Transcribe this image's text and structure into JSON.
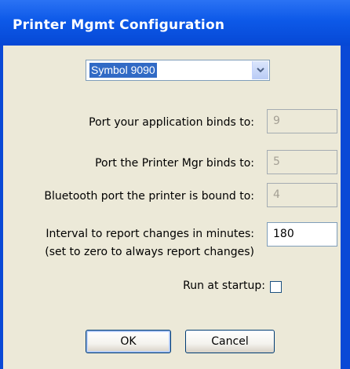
{
  "window": {
    "title": "Printer Mgmt Configuration"
  },
  "printer_select": {
    "selected": "Symbol 9090"
  },
  "fields": [
    {
      "label": "Port your application binds to:",
      "value": "9",
      "enabled": false
    },
    {
      "label": "Port the Printer Mgr binds to:",
      "value": "5",
      "enabled": false
    },
    {
      "label": "Bluetooth port the printer is bound to:",
      "value": "4",
      "enabled": false
    },
    {
      "label": "Interval to report changes in minutes:",
      "sublabel": "(set to zero to always report changes)",
      "value": "180",
      "enabled": true
    }
  ],
  "run_at_startup": {
    "label": "Run at startup:",
    "checked": false
  },
  "buttons": {
    "ok": "OK",
    "cancel": "Cancel"
  },
  "colors": {
    "titlebar": "#0a49d6",
    "dialog_bg": "#ece9d8",
    "selection": "#316ac5"
  },
  "icons": {
    "dropdown": "chevron-down-icon"
  }
}
